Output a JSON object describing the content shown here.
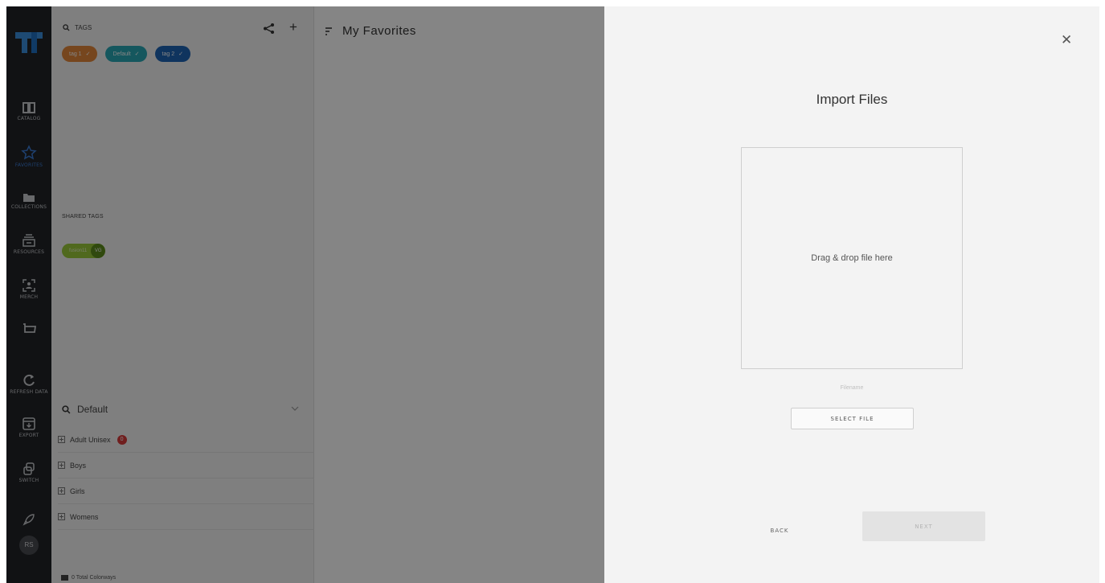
{
  "rail": {
    "items": [
      {
        "label": "CATALOG",
        "icon": "book-icon"
      },
      {
        "label": "FAVORITES",
        "icon": "star-icon"
      },
      {
        "label": "COLLECTIONS",
        "icon": "folder-icon"
      },
      {
        "label": "RESOURCES",
        "icon": "stack-icon"
      },
      {
        "label": "MERCH",
        "icon": "scan-person-icon"
      },
      {
        "label": "",
        "icon": "basket-icon"
      },
      {
        "label": "REFRESH DATA",
        "icon": "refresh-icon"
      },
      {
        "label": "EXPORT",
        "icon": "export-icon"
      },
      {
        "label": "SWITCH",
        "icon": "switch-icon"
      },
      {
        "label": "",
        "icon": "rocket-icon"
      }
    ],
    "avatar": "RS"
  },
  "tags_panel": {
    "header": "TAGS",
    "tags": [
      {
        "label": "tag 1",
        "color": "#e2873a"
      },
      {
        "label": "Default",
        "color": "#2aa8b5"
      },
      {
        "label": "tag 2",
        "color": "#1e64b4"
      }
    ],
    "shared_title": "SHARED TAGS",
    "shared_tag": {
      "label": "fusion11",
      "owner": "VG",
      "color": "#9ac93a"
    },
    "search_value": "Default",
    "tree": [
      {
        "label": "Adult Unisex",
        "badge": "0"
      },
      {
        "label": "Boys"
      },
      {
        "label": "Girls"
      },
      {
        "label": "Womens"
      }
    ],
    "footer": "0 Total Colorways"
  },
  "favorites": {
    "title": "My Favorites"
  },
  "modal": {
    "title": "Import Files",
    "dropzone": "Drag & drop file here",
    "filename": "Filename",
    "select_file": "SELECT FILE",
    "back": "BACK",
    "next": "NEXT"
  }
}
